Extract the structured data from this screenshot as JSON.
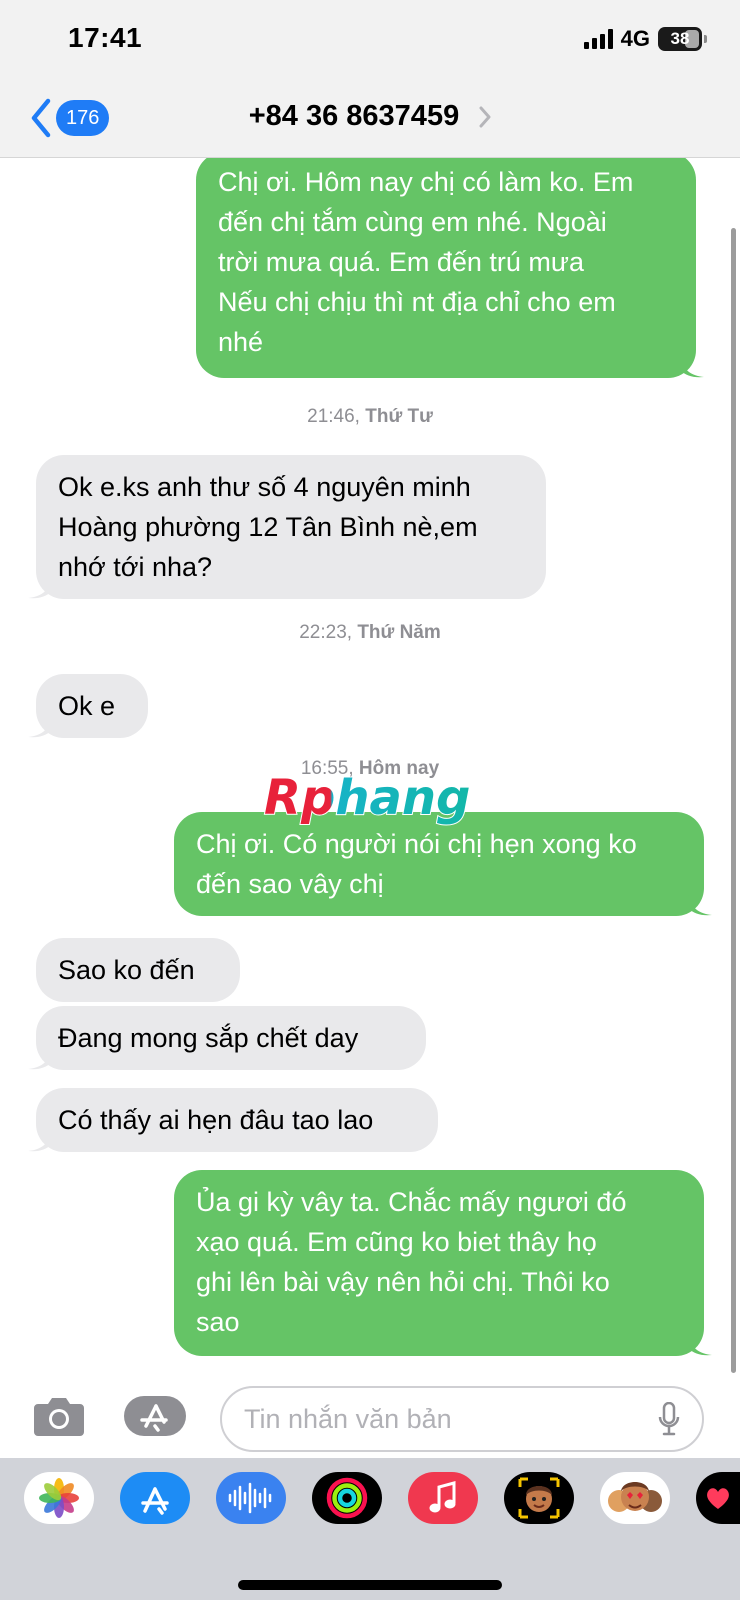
{
  "status_bar": {
    "time": "17:41",
    "network": "4G",
    "battery": "38",
    "battery_level": 0.38
  },
  "header": {
    "back_count": "176",
    "contact": "+84 36 8637459"
  },
  "messages": [
    {
      "dir": "out",
      "lines": [
        "Chị ơi. Hôm nay chị có làm ko. Em",
        "đến chị tắm cùng em nhé. Ngoài",
        "trời mưa quá. Em đến trú mưa",
        "Nếu chị chịu thì nt địa chỉ cho em",
        "nhé"
      ]
    },
    {
      "dir": "in",
      "lines": [
        "Ok e.ks anh thư số 4 nguyên minh",
        "Hoàng phường 12 Tân Bình nè,em",
        "nhớ tới nha?"
      ]
    },
    {
      "dir": "in",
      "lines": [
        "Ok e"
      ]
    },
    {
      "dir": "out",
      "lines": [
        "Chị ơi. Có người nói chị hẹn xong ko",
        "đến sao vây chị"
      ]
    },
    {
      "dir": "in",
      "lines": [
        "Sao ko đến"
      ]
    },
    {
      "dir": "in",
      "lines": [
        "Đang mong sắp chết day"
      ]
    },
    {
      "dir": "in",
      "lines": [
        "Có thấy ai hẹn đâu tao lao"
      ]
    },
    {
      "dir": "out",
      "lines": [
        "Ủa gi kỳ vây ta.  Chắc mấy ngươi đó",
        "xạo quá. Em cũng ko biet thây họ",
        "ghi lên bài vậy nên hỏi chị. Thôi ko",
        "sao"
      ]
    }
  ],
  "timestamps": [
    {
      "time": "21:46",
      "day": "Thứ Tư"
    },
    {
      "time": "22:23",
      "day": "Thứ Năm"
    },
    {
      "time": "16:55",
      "day": "Hôm nay"
    }
  ],
  "watermark": "Rphang",
  "compose": {
    "placeholder": "Tin nhắn văn bản"
  },
  "app_drawer": [
    "photos-icon",
    "app-store-icon",
    "audio-message-icon",
    "activity-icon",
    "music-icon",
    "memoji-icon",
    "memoji-stickers-icon",
    "digital-touch-icon"
  ]
}
